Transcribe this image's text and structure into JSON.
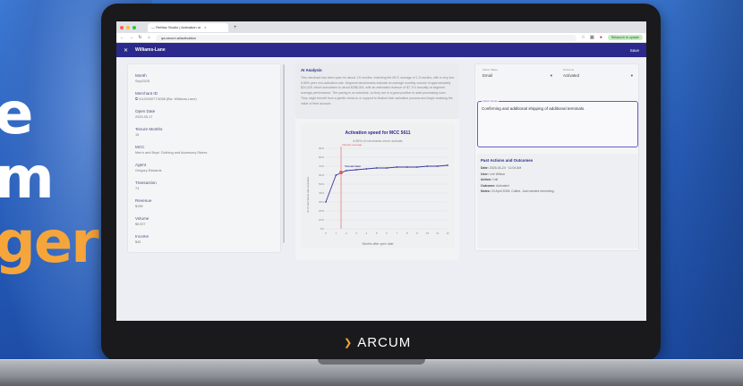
{
  "background": {
    "big_letters": [
      "e",
      "m",
      "ger"
    ]
  },
  "brand": {
    "logo_text": "ARCUM",
    "accent": "#f6a53a"
  },
  "browser": {
    "tab_title": "— ReMax Studio | Activation m",
    "url": "qa.arcum.ai/activation",
    "relaunch_label": "Relaunch to update"
  },
  "app": {
    "title": "Williams-Lane",
    "save_label": "Save",
    "header_color": "#2b2a8c"
  },
  "merchant": {
    "fields": [
      {
        "label": "Month",
        "value": "Sep/2025"
      },
      {
        "label": "Merchant ID",
        "value": "1112003077:5056 (Biz: Williams-Lane)"
      },
      {
        "label": "Open Date",
        "value": "2025-05-17"
      },
      {
        "label": "Tenure Months",
        "value": "15"
      },
      {
        "label": "MCC",
        "value": "Men's and Boys' Clothing and Accessory Stores"
      },
      {
        "label": "Agent",
        "value": "Gregory Edwards"
      },
      {
        "label": "Transaction",
        "value": "74"
      },
      {
        "label": "Revenue",
        "value": "$198"
      },
      {
        "label": "Volume",
        "value": "$5,927"
      },
      {
        "label": "Income",
        "value": "$45"
      }
    ]
  },
  "ai_analysis": {
    "title": "AI Analysis",
    "text": "This merchant has been open for about 1.5 months, matching the MCC average of 1.5 months, with a very low 6.86% peer non-activation rate. Segment benchmarks indicate an average monthly volume of approximately $24,025, which annualizes to about $288,304, with an estimated revenue of $7,714 annually at segment average performance. The pacing is on schedule, so they are in a good position to start processing soon. They might benefit from a gentle check-in or support to finalize their activation process and begin realizing the value of their account."
  },
  "chart_data": {
    "type": "line",
    "title": "Activation speed for MCC 5611",
    "subtitle": "6.86% of merchants never activate",
    "xlabel": "Months after open date",
    "ylabel": "% of merchants that activated",
    "x": [
      0,
      1,
      2,
      3,
      4,
      5,
      6,
      7,
      8,
      9,
      10,
      11,
      12
    ],
    "y": [
      30,
      60,
      65,
      66,
      67,
      68,
      68,
      69,
      69,
      69,
      70,
      70,
      71
    ],
    "ylim": [
      0,
      90
    ],
    "yticks": [
      "0%",
      "10%",
      "20%",
      "30%",
      "40%",
      "50%",
      "60%",
      "70%",
      "80%",
      "90%"
    ],
    "marker": {
      "x": 1.5,
      "y": 63,
      "label": "You are here"
    },
    "reference_line": {
      "x": 1.5,
      "label": "Industry average"
    },
    "series_color": "#3b3aa0",
    "reference_color": "#e05a5a"
  },
  "actions": {
    "action_taken": {
      "label": "Action Taken",
      "value": "Email"
    },
    "outcome": {
      "label": "Outcome",
      "value": "Activated"
    },
    "notes": {
      "label": "Action Notes",
      "value": "Confirming and additional shipping of additional terminals."
    },
    "past_title": "Past Actions and Outcomes",
    "past": [
      {
        "k": "Date:",
        "v": "2026-04-24 · 11:04 AM"
      },
      {
        "k": "User:",
        "v": "Lee Wilson"
      },
      {
        "k": "Action:",
        "v": "Call"
      },
      {
        "k": "Outcome:",
        "v": "Activated"
      },
      {
        "k": "Notes:",
        "v": "24 April 2026: Called. Just needed reminding."
      }
    ]
  }
}
